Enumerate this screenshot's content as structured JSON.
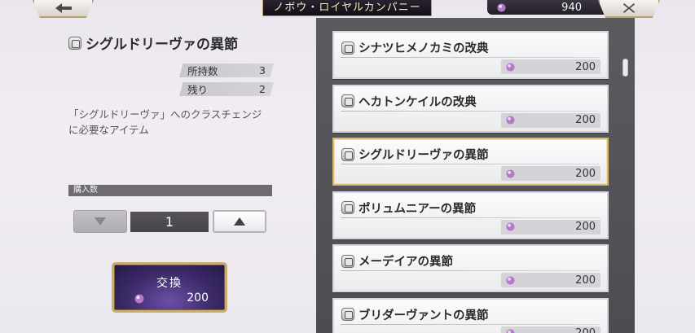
{
  "header": {
    "shop_title": "ノボウ・ロイヤルカンパニー",
    "currency_amount": "940",
    "back_icon": "back-arrow-icon",
    "close_icon": "close-icon"
  },
  "detail": {
    "item_name": "シグルドリーヴァの異節",
    "owned_label": "所持数",
    "owned_value": "3",
    "remaining_label": "残り",
    "remaining_value": "2",
    "description": "「シグルドリーヴァ」へのクラスチェンジに必要なアイテム",
    "quantity_header": "購入数",
    "quantity_value": "1",
    "exchange_label": "交換",
    "exchange_cost": "200"
  },
  "items": [
    {
      "name": "シナツヒメノカミの改典",
      "price": "200",
      "selected": false
    },
    {
      "name": "ヘカトンケイルの改典",
      "price": "200",
      "selected": false
    },
    {
      "name": "シグルドリーヴァの異節",
      "price": "200",
      "selected": true
    },
    {
      "name": "ポリュムニアーの異節",
      "price": "200",
      "selected": false
    },
    {
      "name": "メーデイアの異節",
      "price": "200",
      "selected": false
    },
    {
      "name": "ブリダーヴァントの異節",
      "price": "200",
      "selected": false
    }
  ],
  "colors": {
    "accent_gold": "#c9ae6f",
    "exchange_purple": "#3c2a69",
    "currency_orb": "#b678c8"
  }
}
